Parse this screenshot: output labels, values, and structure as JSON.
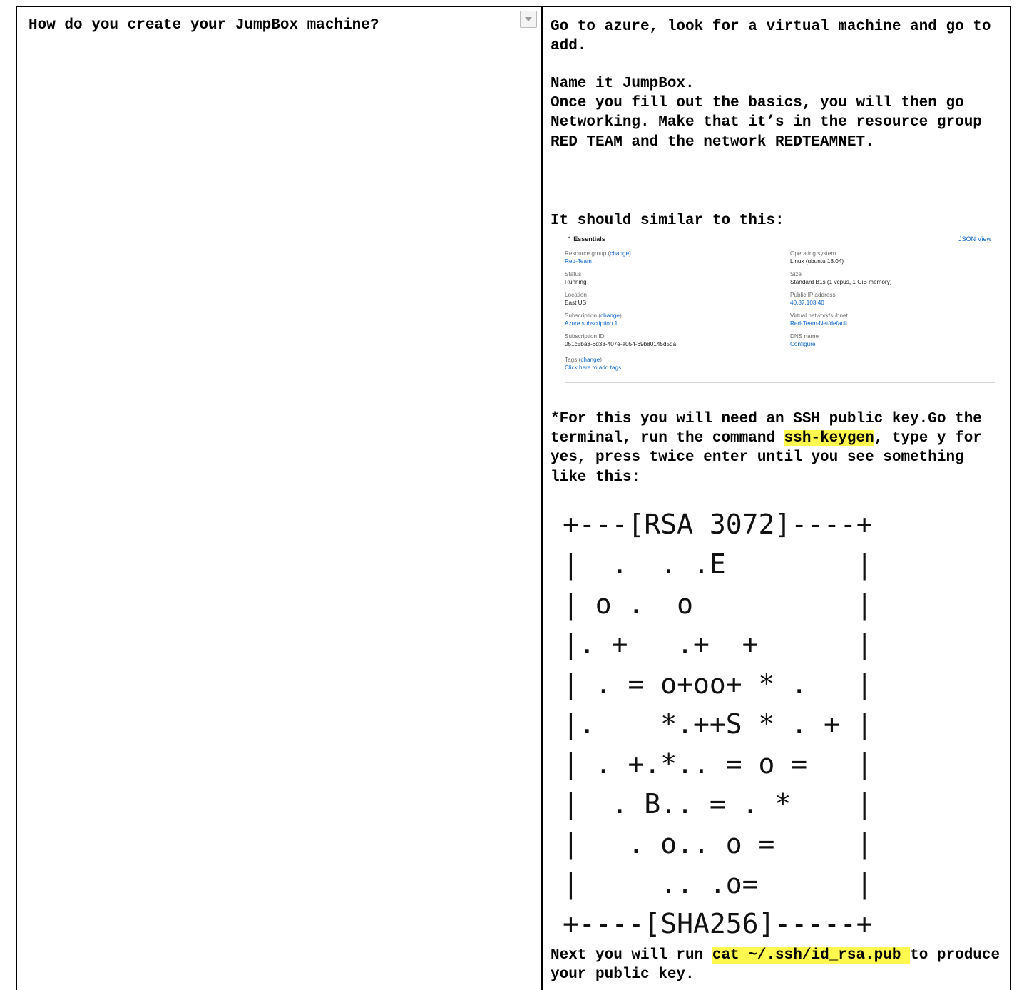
{
  "question": {
    "text": "How do you create your JumpBox machine?"
  },
  "answer": {
    "p1": "Go to azure, look for a virtual machine and go to add.",
    "p2a": "Name it JumpBox.",
    "p2b": "Once you fill out the basics, you will then go Networking. Make that it’s in the resource group RED TEAM and the network REDTEAMNET.",
    "p3": "It should similar to this:",
    "p4_pre": "*For this you will need an SSH public key.Go the terminal, run the command ",
    "p4_cmd": "ssh-keygen",
    "p4_post": ", type y for yes, press twice enter until you see something like this:",
    "p5_pre": "Next you will run ",
    "p5_cmd": "cat ~/.ssh/id_rsa.pub ",
    "p5_post": "to produce your public key."
  },
  "essentials": {
    "title": "Essentials",
    "json_view": "JSON View",
    "change": "change",
    "left": {
      "resource_group_label": "Resource group",
      "resource_group_value": "Red-Team",
      "status_label": "Status",
      "status_value": "Running",
      "location_label": "Location",
      "location_value": "East US",
      "subscription_label": "Subscription",
      "subscription_value": "Azure subscription 1",
      "subscription_id_label": "Subscription ID",
      "subscription_id_value": "051c5ba3-6d38-407e-a054-69b80145d5da",
      "tags_label": "Tags",
      "tags_value": "Click here to add tags"
    },
    "right": {
      "os_label": "Operating system",
      "os_value": "Linux (ubuntu 18.04)",
      "size_label": "Size",
      "size_value": "Standard B1s (1 vcpus, 1 GiB memory)",
      "public_ip_label": "Public IP address",
      "public_ip_value": "40.87.103.40",
      "vnet_label": "Virtual network/subnet",
      "vnet_value": "Red-Team-Net/default",
      "dns_label": "DNS name",
      "dns_value": "Configure"
    }
  },
  "rsa_art": {
    "l0": "+---[RSA 3072]----+",
    "l1": "|  .  . .E        |",
    "l2": "| o .  o          |",
    "l3": "|. +   .+  +      |",
    "l4": "| . = o+oo+ * .   |",
    "l5": "|.    *.++S * . + |",
    "l6": "| . +.*.. = o =   |",
    "l7": "|  . B.. = . *    |",
    "l8": "|   . o.. o =     |",
    "l9": "|     .. .o=      |",
    "l10": "+----[SHA256]-----+"
  }
}
